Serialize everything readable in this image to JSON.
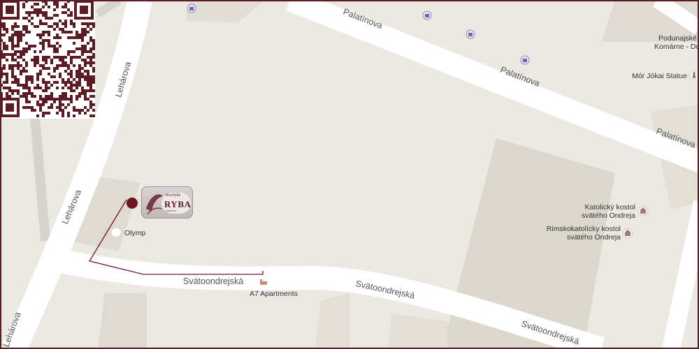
{
  "streets": {
    "palatinova": "Palatínova",
    "leharova": "Lehárova",
    "svatoondrejska": "Svätoondrejská"
  },
  "pois": {
    "olymp": "Olymp",
    "a7_apartments": "A7 Apartments",
    "katolicky_kostol_1": "Katolický kostol",
    "katolicky_kostol_2": "svätého Ondreja",
    "rimskokatolicky_1": "Rimskokatolícky kostol",
    "rimskokatolicky_2": "svätého Ondreja",
    "mor_jokai": "Mór Jókai Statue",
    "podunajske_1": "Podunajské I",
    "podunajske_2": "Komárne - Du"
  },
  "logo": {
    "name": "RYBA",
    "prefix": "Kuchyňa",
    "caption": "reštaurácia"
  },
  "colors": {
    "frame": "#5b1d23",
    "marker": "#6d1520",
    "road": "#ffffff",
    "block": "#ddd8ce",
    "ground": "#ece9e2"
  },
  "icons": {
    "shop": "shopping-bag-icon",
    "hotel": "hotel-bed-icon",
    "church": "church-icon",
    "monument": "monument-icon"
  }
}
